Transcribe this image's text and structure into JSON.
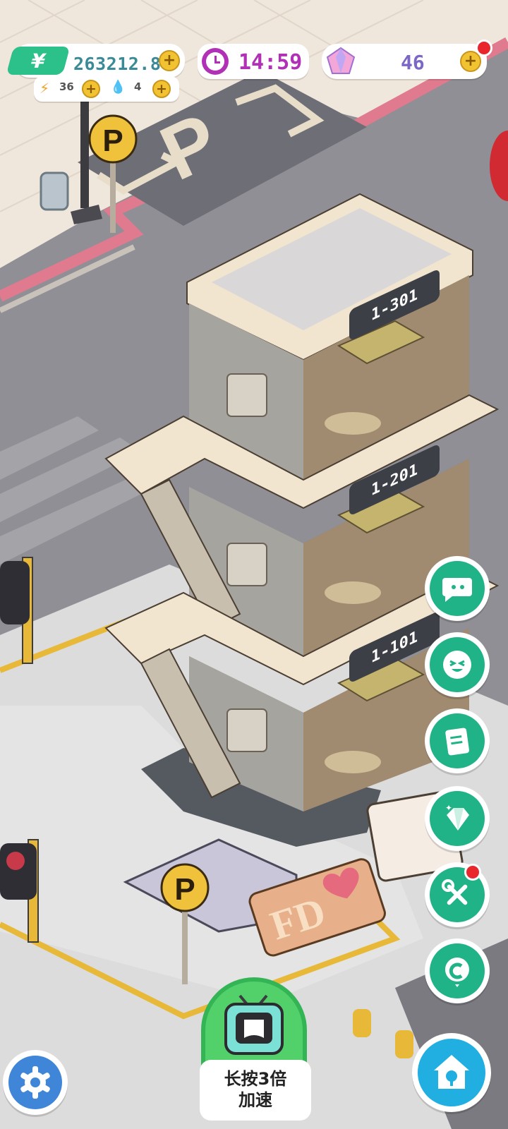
{
  "hud": {
    "money": "263212.88",
    "timer": "14:59",
    "gems": "46",
    "energy": "36",
    "water": "4"
  },
  "rooms": [
    {
      "label": "1-301"
    },
    {
      "label": "1-201"
    },
    {
      "label": "1-101"
    }
  ],
  "signs": {
    "parking": "P",
    "billboard": "FD"
  },
  "speed_button": {
    "line1": "长按3倍",
    "line2": "加速"
  },
  "side_buttons": [
    {
      "icon": "chat-bubble-icon"
    },
    {
      "icon": "smiley-face-icon"
    },
    {
      "icon": "notes-icon"
    },
    {
      "icon": "diamond-icon"
    },
    {
      "icon": "tools-icon"
    },
    {
      "icon": "copyright-coin-icon"
    }
  ],
  "colors": {
    "accent_green": "#1fb387",
    "money_text": "#3a8a98",
    "timer_text": "#b030b6",
    "gem_text": "#7d67c6",
    "coin_yellow": "#f1c232"
  }
}
